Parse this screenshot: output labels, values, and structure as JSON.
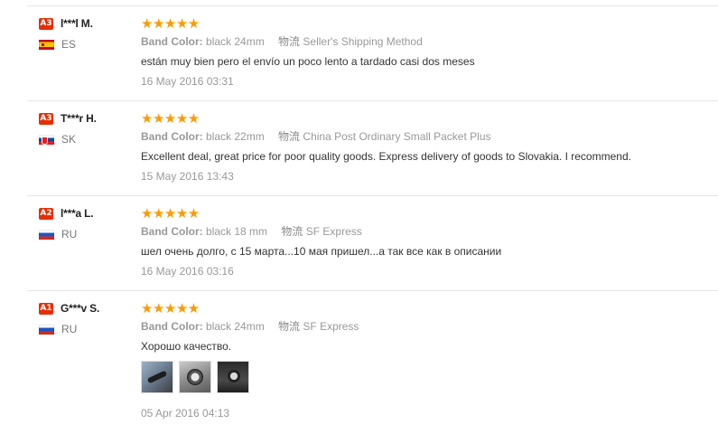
{
  "reviews": [
    {
      "level": "A3",
      "name": "l***l M.",
      "country": "ES",
      "rating": 5,
      "stars": "★★★★★",
      "band_color_label": "Band Color:",
      "band_color": "black 24mm",
      "shipping_label": "物流",
      "shipping": "Seller's Shipping Method",
      "text": "están muy bien pero el envío un poco lento a tardado casi dos meses",
      "date": "16 May 2016 03:31"
    },
    {
      "level": "A3",
      "name": "T***r H.",
      "country": "SK",
      "rating": 5,
      "stars": "★★★★★",
      "band_color_label": "Band Color:",
      "band_color": "black 22mm",
      "shipping_label": "物流",
      "shipping": "China Post Ordinary Small Packet Plus",
      "text": "Excellent deal, great price for poor quality goods. Express delivery of goods to Slovakia. I recommend.",
      "date": "15 May 2016 13:43"
    },
    {
      "level": "A2",
      "name": "l***a L.",
      "country": "RU",
      "rating": 5,
      "stars": "★★★★★",
      "band_color_label": "Band Color:",
      "band_color": "black 18 mm",
      "shipping_label": "物流",
      "shipping": "SF Express",
      "text": "шел очень долго, с 15 марта...10 мая пришел...а так все как в описании",
      "date": "16 May 2016 03:16"
    },
    {
      "level": "A1",
      "name": "G***v S.",
      "country": "RU",
      "rating": 5,
      "stars": "★★★★★",
      "band_color_label": "Band Color:",
      "band_color": "black 24mm",
      "shipping_label": "物流",
      "shipping": "SF Express",
      "text": "Хорошо качество.",
      "date": "05 Apr 2016 04:13"
    }
  ],
  "colors": {
    "badge": "#e62e04",
    "stars": "#ff9a00"
  }
}
